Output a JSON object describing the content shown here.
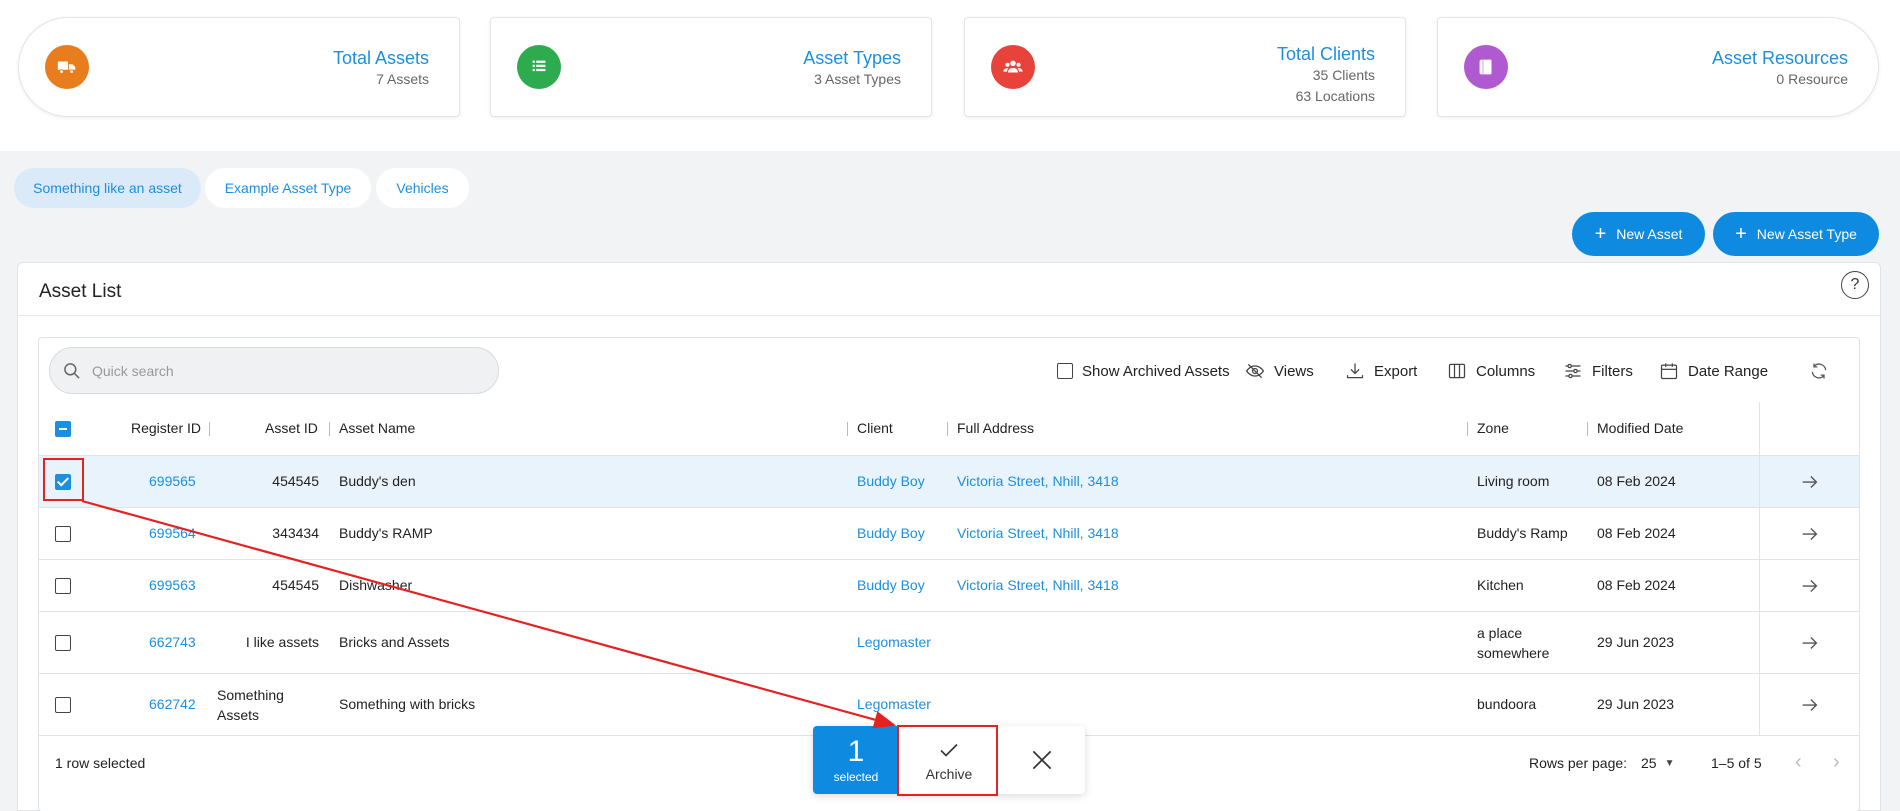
{
  "stats": [
    {
      "title": "Total Assets",
      "lines": [
        "7 Assets"
      ],
      "color": "#e87d1e",
      "icon": "truck-icon"
    },
    {
      "title": "Asset Types",
      "lines": [
        "3 Asset Types"
      ],
      "color": "#2eaa4f",
      "icon": "list-icon"
    },
    {
      "title": "Total Clients",
      "lines": [
        "35 Clients",
        "63 Locations"
      ],
      "color": "#e8433a",
      "icon": "users-icon"
    },
    {
      "title": "Asset Resources",
      "lines": [
        "0 Resource"
      ],
      "color": "#b05ad1",
      "icon": "book-icon"
    }
  ],
  "tabs": [
    {
      "label": "Something like an asset",
      "active": true
    },
    {
      "label": "Example Asset Type",
      "active": false
    },
    {
      "label": "Vehicles",
      "active": false
    }
  ],
  "buttons": {
    "new_asset": "New Asset",
    "new_asset_type": "New Asset Type"
  },
  "panel": {
    "title": "Asset List",
    "help": "?"
  },
  "search": {
    "placeholder": "Quick search",
    "value": ""
  },
  "toolbar": {
    "show_archived": "Show Archived Assets",
    "views": "Views",
    "export": "Export",
    "columns": "Columns",
    "filters": "Filters",
    "date_range": "Date Range"
  },
  "table": {
    "headers": {
      "register_id": "Register ID",
      "asset_id": "Asset ID",
      "asset_name": "Asset Name",
      "client": "Client",
      "full_address": "Full Address",
      "zone": "Zone",
      "modified_date": "Modified Date"
    },
    "rows": [
      {
        "register_id": "699565",
        "asset_id": "454545",
        "asset_name": "Buddy's den",
        "client": "Buddy Boy",
        "full_address": "Victoria Street, Nhill, 3418",
        "zone": "Living room",
        "modified_date": "08 Feb 2024",
        "selected": true
      },
      {
        "register_id": "699564",
        "asset_id": "343434",
        "asset_name": "Buddy's RAMP",
        "client": "Buddy Boy",
        "full_address": "Victoria Street, Nhill, 3418",
        "zone": "Buddy's Ramp",
        "modified_date": "08 Feb 2024",
        "selected": false
      },
      {
        "register_id": "699563",
        "asset_id": "454545",
        "asset_name": "Dishwasher",
        "client": "Buddy Boy",
        "full_address": "Victoria Street, Nhill, 3418",
        "zone": "Kitchen",
        "modified_date": "08 Feb 2024",
        "selected": false
      },
      {
        "register_id": "662743",
        "asset_id": "I like assets",
        "asset_name": "Bricks and Assets",
        "client": "Legomaster",
        "full_address": "",
        "zone": "a place somewhere",
        "modified_date": "29 Jun 2023",
        "selected": false
      },
      {
        "register_id": "662742",
        "asset_id": "Something Assets",
        "asset_name": "Something with bricks",
        "client": "Legomaster",
        "full_address": "",
        "zone": "bundoora",
        "modified_date": "29 Jun 2023",
        "selected": false
      }
    ]
  },
  "footer": {
    "selection": "1 row selected",
    "rows_per_page_label": "Rows per page:",
    "rows_per_page": "25",
    "range": "1–5 of 5"
  },
  "action_bar": {
    "count": "1",
    "count_label": "selected",
    "archive": "Archive"
  },
  "annotation_color": "#e32222"
}
